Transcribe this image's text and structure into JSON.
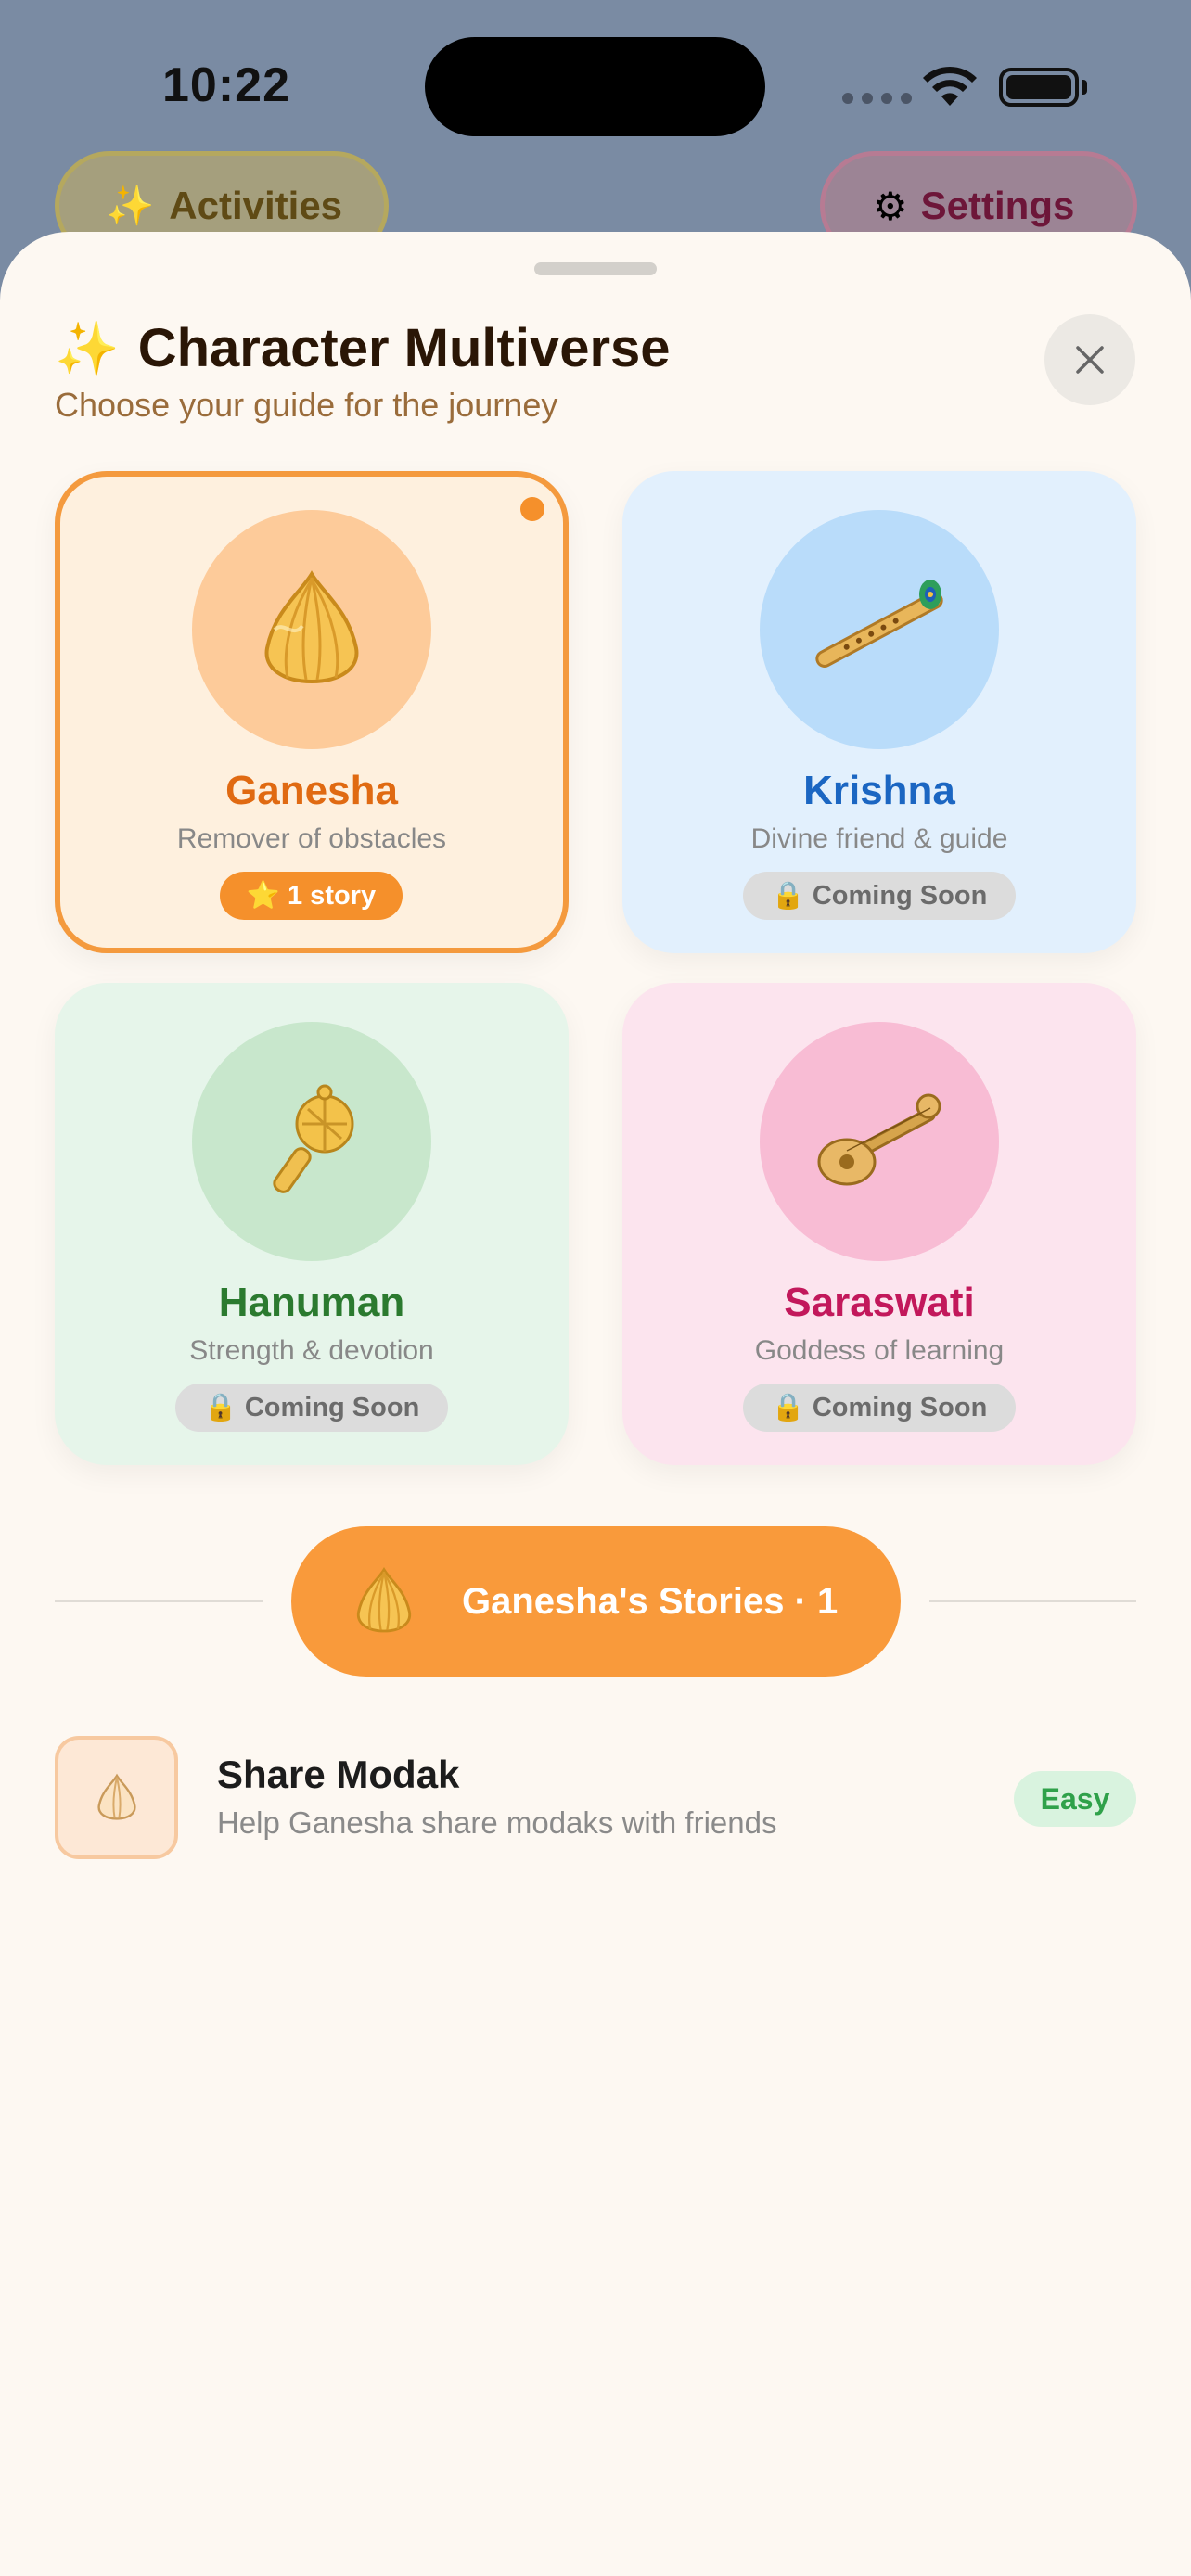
{
  "status_bar": {
    "time": "10:22"
  },
  "background_pills": {
    "activities": {
      "icon": "sparkles-icon",
      "label": "Activities"
    },
    "settings": {
      "icon": "gear-icon",
      "label": "Settings"
    }
  },
  "sheet": {
    "title_icon": "sparkles-icon",
    "title": "Character Multiverse",
    "subtitle": "Choose your guide for the journey"
  },
  "characters": [
    {
      "name": "Ganesha",
      "description": "Remover of obstacles",
      "badge": "1 story",
      "badge_icon": "star-icon",
      "icon": "modak-icon",
      "selected": true,
      "color": "#e06a12"
    },
    {
      "name": "Krishna",
      "description": "Divine friend & guide",
      "badge": "Coming Soon",
      "badge_icon": "lock-icon",
      "icon": "flute-icon",
      "selected": false,
      "color": "#1b66c2"
    },
    {
      "name": "Hanuman",
      "description": "Strength & devotion",
      "badge": "Coming Soon",
      "badge_icon": "lock-icon",
      "icon": "mace-icon",
      "selected": false,
      "color": "#2b7a2f"
    },
    {
      "name": "Saraswati",
      "description": "Goddess of learning",
      "badge": "Coming Soon",
      "badge_icon": "lock-icon",
      "icon": "veena-icon",
      "selected": false,
      "color": "#c2185b"
    }
  ],
  "stories_header": {
    "icon": "modak-icon",
    "label": "Ganesha's Stories · 1"
  },
  "stories": [
    {
      "icon": "modak-icon",
      "title": "Share Modak",
      "description": "Help Ganesha share modaks with friends",
      "difficulty": "Easy"
    }
  ],
  "colors": {
    "accent": "#f99a3b",
    "sheet_bg": "#fdf8f2",
    "easy": "#2fa14a"
  }
}
